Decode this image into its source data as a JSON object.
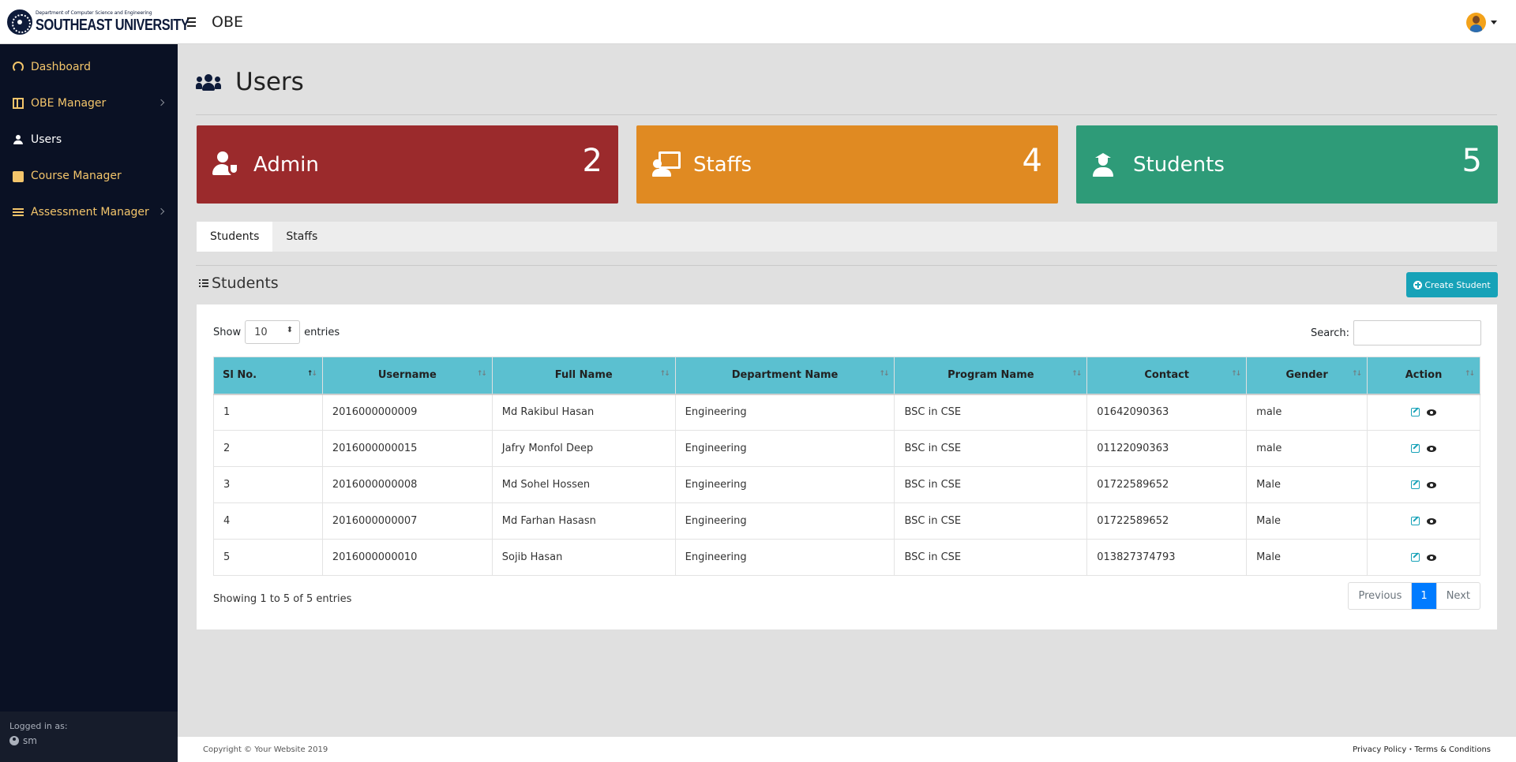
{
  "brand": {
    "department": "Department of Computer Science and Engineering",
    "university": "SOUTHEAST UNIVERSITY",
    "app_title": "OBE"
  },
  "sidebar": {
    "items": [
      {
        "label": "Dashboard",
        "icon": "tachometer-icon"
      },
      {
        "label": "OBE Manager",
        "icon": "table-icon"
      },
      {
        "label": "Users",
        "icon": "users-icon"
      },
      {
        "label": "Course Manager",
        "icon": "briefcase-icon"
      },
      {
        "label": "Assessment Manager",
        "icon": "list-icon"
      }
    ],
    "logged_in_label": "Logged in as:",
    "logged_in_user": "sm"
  },
  "page": {
    "title": "Users"
  },
  "stats": {
    "admin": {
      "label": "Admin",
      "count": "2",
      "color": "#9b2a2c"
    },
    "staffs": {
      "label": "Staffs",
      "count": "4",
      "color": "#e08a22"
    },
    "students": {
      "label": "Students",
      "count": "5",
      "color": "#2e9b78"
    }
  },
  "tabs": [
    {
      "label": "Students"
    },
    {
      "label": "Staffs"
    }
  ],
  "section": {
    "title": "Students",
    "create_label": "Create Student"
  },
  "table_controls": {
    "show_label": "Show",
    "entries_value": "10",
    "entries_label": "entries",
    "search_label": "Search:",
    "search_value": ""
  },
  "table": {
    "headers": [
      "Sl No.",
      "Username",
      "Full Name",
      "Department Name",
      "Program Name",
      "Contact",
      "Gender",
      "Action"
    ],
    "rows": [
      {
        "sl": "1",
        "username": "2016000000009",
        "name": "Md Rakibul Hasan",
        "dept": "Engineering",
        "program": "BSC in CSE",
        "contact": "01642090363",
        "gender": "male"
      },
      {
        "sl": "2",
        "username": "2016000000015",
        "name": "Jafry Monfol Deep",
        "dept": "Engineering",
        "program": "BSC in CSE",
        "contact": "01122090363",
        "gender": "male"
      },
      {
        "sl": "3",
        "username": "2016000000008",
        "name": "Md Sohel Hossen",
        "dept": "Engineering",
        "program": "BSC in CSE",
        "contact": "01722589652",
        "gender": "Male"
      },
      {
        "sl": "4",
        "username": "2016000000007",
        "name": "Md Farhan Hasasn",
        "dept": "Engineering",
        "program": "BSC in CSE",
        "contact": "01722589652",
        "gender": "Male"
      },
      {
        "sl": "5",
        "username": "2016000000010",
        "name": "Sojib Hasan",
        "dept": "Engineering",
        "program": "BSC in CSE",
        "contact": "013827374793",
        "gender": "Male"
      }
    ],
    "info": "Showing 1 to 5 of 5 entries"
  },
  "pagination": {
    "previous": "Previous",
    "current": "1",
    "next": "Next"
  },
  "footer": {
    "copyright": "Copyright © Your Website 2019",
    "privacy": "Privacy Policy",
    "separator": "·",
    "terms": "Terms & Conditions"
  },
  "colors": {
    "sidebar_bg": "#0a1124",
    "nav_text": "#f3c56b",
    "table_header": "#5bc0d0",
    "create_button": "#17a2b8",
    "page_active": "#007bff"
  }
}
